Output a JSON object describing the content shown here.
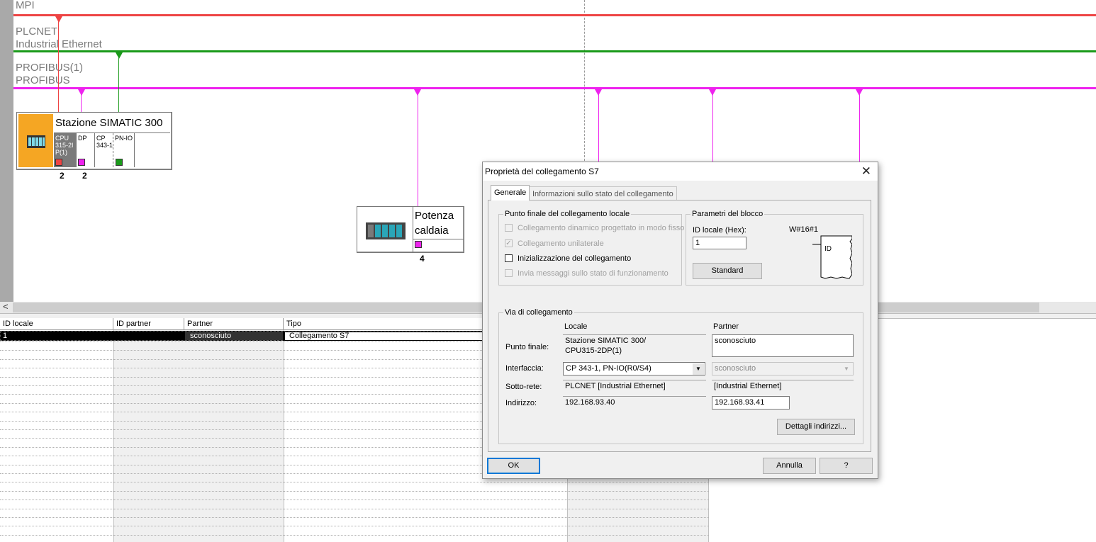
{
  "network": {
    "mpi_label": "MPI",
    "plcnet_label1": "PLCNET",
    "plcnet_label2": "Industrial Ethernet",
    "profibus_label1": "PROFIBUS(1)",
    "profibus_label2": "PROFIBUS",
    "colors": {
      "mpi": "#ee4444",
      "ethernet": "#1a9a1a",
      "profibus": "#ee22ee",
      "cpu_bg": "#f5a623"
    },
    "station1": {
      "title": "Stazione SIMATIC 300",
      "slots": [
        "CPU 315-2DP(1)",
        "DP",
        "CP 343-1",
        "PN-IO"
      ],
      "slot_cpu_lines": [
        "CPU",
        "315-2I",
        "P(1)"
      ],
      "slot_cp_lines": [
        "CP",
        "343-1"
      ],
      "port_labels": [
        "2",
        "2"
      ]
    },
    "station2": {
      "title_line1": "Potenza",
      "title_line2": "caldaia",
      "port_label": "4"
    }
  },
  "scrollbar": {
    "left_arrow": "<"
  },
  "table": {
    "headers": [
      "ID locale",
      "ID partner",
      "Partner",
      "Tipo"
    ],
    "rows": [
      {
        "id_locale": "1",
        "id_partner": "",
        "partner": "sconosciuto",
        "tipo": "Collegamento S7"
      }
    ]
  },
  "dialog": {
    "title": "Proprietà del collegamento S7",
    "close_icon": "✕",
    "tabs": [
      "Generale",
      "Informazioni sullo stato del collegamento"
    ],
    "local_endpoint": {
      "group_label": "Punto finale del collegamento locale",
      "options": [
        {
          "label": "Collegamento dinamico progettato in modo fisso",
          "checked": false,
          "enabled": false
        },
        {
          "label": "Collegamento unilaterale",
          "checked": true,
          "enabled": false
        },
        {
          "label": "Inizializzazione del collegamento",
          "checked": false,
          "enabled": true
        },
        {
          "label": "Invia messaggi sullo stato di funzionamento",
          "checked": false,
          "enabled": false
        }
      ]
    },
    "block_params": {
      "group_label": "Parametri del blocco",
      "id_label": "ID locale (Hex):",
      "id_value": "1",
      "w_value": "W#16#1",
      "id_box_label": "ID",
      "standard_button": "Standard"
    },
    "connection_path": {
      "group_label": "Via di collegamento",
      "col_local": "Locale",
      "col_partner": "Partner",
      "row_labels": [
        "Punto finale:",
        "Interfaccia:",
        "Sotto-rete:",
        "Indirizzo:"
      ],
      "local_endpoint_line1": "Stazione SIMATIC 300/",
      "local_endpoint_line2": "CPU315-2DP(1)",
      "partner_endpoint": "sconosciuto",
      "local_interface": "CP 343-1, PN-IO(R0/S4)",
      "partner_interface": "sconosciuto",
      "local_subnet": "PLCNET [Industrial Ethernet]",
      "partner_subnet": "[Industrial Ethernet]",
      "local_address": "192.168.93.40",
      "partner_address": "192.168.93.41",
      "details_button": "Dettagli indirizzi..."
    },
    "buttons": {
      "ok": "OK",
      "cancel": "Annulla",
      "help": "?"
    }
  }
}
